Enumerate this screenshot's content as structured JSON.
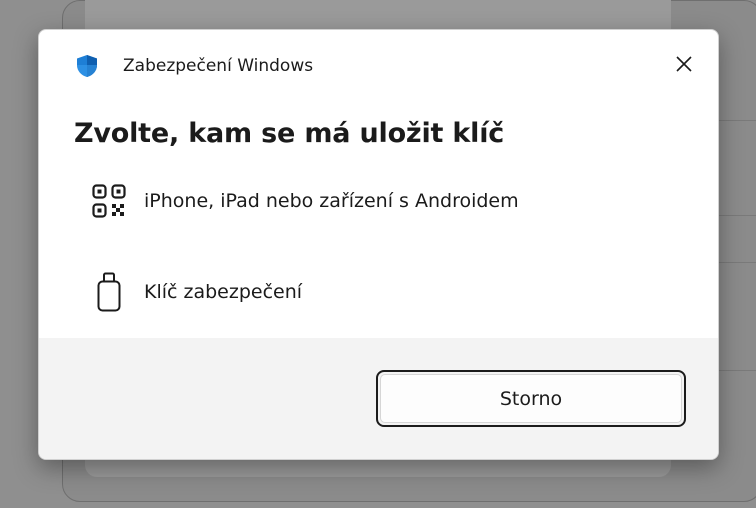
{
  "window": {
    "app_title": "Zabezpečení Windows",
    "close_icon": "close-icon",
    "shield_icon": "shield-icon"
  },
  "dialog": {
    "heading": "Zvolte, kam se má uložit klíč",
    "options": [
      {
        "label": "iPhone, iPad nebo zařízení s Androidem",
        "icon": "qr-code-icon"
      },
      {
        "label": "Klíč zabezpečení",
        "icon": "usb-key-icon"
      }
    ],
    "cancel_label": "Storno"
  },
  "colors": {
    "overlay": "#8f8f8f",
    "dialog_bg": "#ffffff",
    "footer_bg": "#f3f3f3",
    "shield_blue": "#1e7fd6",
    "text": "#1b1b1b"
  }
}
